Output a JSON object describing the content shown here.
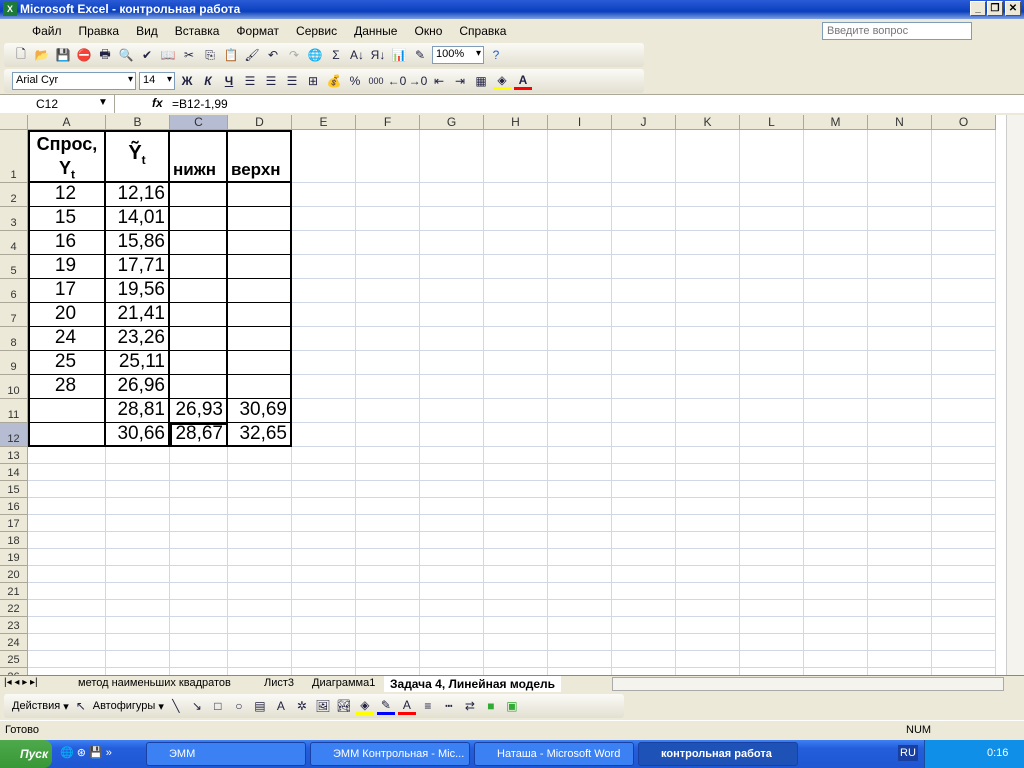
{
  "window": {
    "title": "Microsoft Excel - контрольная работа"
  },
  "menu": [
    "Файл",
    "Правка",
    "Вид",
    "Вставка",
    "Формат",
    "Сервис",
    "Данные",
    "Окно",
    "Справка"
  ],
  "ask_placeholder": "Введите вопрос",
  "toolbar": {
    "zoom": "100%",
    "font": "Arial Cyr",
    "size": "14",
    "bold": "Ж",
    "italic": "К",
    "underline": "Ч",
    "percent": "%",
    "thousands": "000"
  },
  "formula_bar": {
    "name_box": "C12",
    "fx": "fx",
    "formula": "=B12-1,99"
  },
  "columns": [
    "A",
    "B",
    "C",
    "D",
    "E",
    "F",
    "G",
    "H",
    "I",
    "J",
    "K",
    "L",
    "M",
    "N",
    "O"
  ],
  "active_cell": "C12",
  "cells": {
    "A1": "Спрос, Yt",
    "B1": "Ỹt",
    "C1": "нижн",
    "D1": "верхн",
    "A2": "12",
    "B2": "12,16",
    "A3": "15",
    "B3": "14,01",
    "A4": "16",
    "B4": "15,86",
    "A5": "19",
    "B5": "17,71",
    "A6": "17",
    "B6": "19,56",
    "A7": "20",
    "B7": "21,41",
    "A8": "24",
    "B8": "23,26",
    "A9": "25",
    "B9": "25,11",
    "A10": "28",
    "B10": "26,96",
    "B11": "28,81",
    "C11": "26,93",
    "D11": "30,69",
    "B12": "30,66",
    "C12": "28,67",
    "D12": "32,65"
  },
  "header_parts": {
    "a1_line1": "Спрос,",
    "a1_line2": "Y",
    "sub": "t",
    "b1": "Ỹ"
  },
  "sheet_tabs": [
    "метод наименьших квадратов",
    "Лист3",
    "Диаграмма1",
    "Задача 4, Линейная модель"
  ],
  "active_tab": 3,
  "drawing": {
    "actions": "Действия",
    "autoshapes": "Автофигуры"
  },
  "status": {
    "text": "Готово",
    "num": "NUM"
  },
  "taskbar": {
    "start": "Пуск",
    "tasks": [
      "ЭММ",
      "ЭММ Контрольная - Mic...",
      "Наташа - Microsoft Word",
      "контрольная работа"
    ],
    "lang": "RU",
    "clock": "0:16"
  }
}
